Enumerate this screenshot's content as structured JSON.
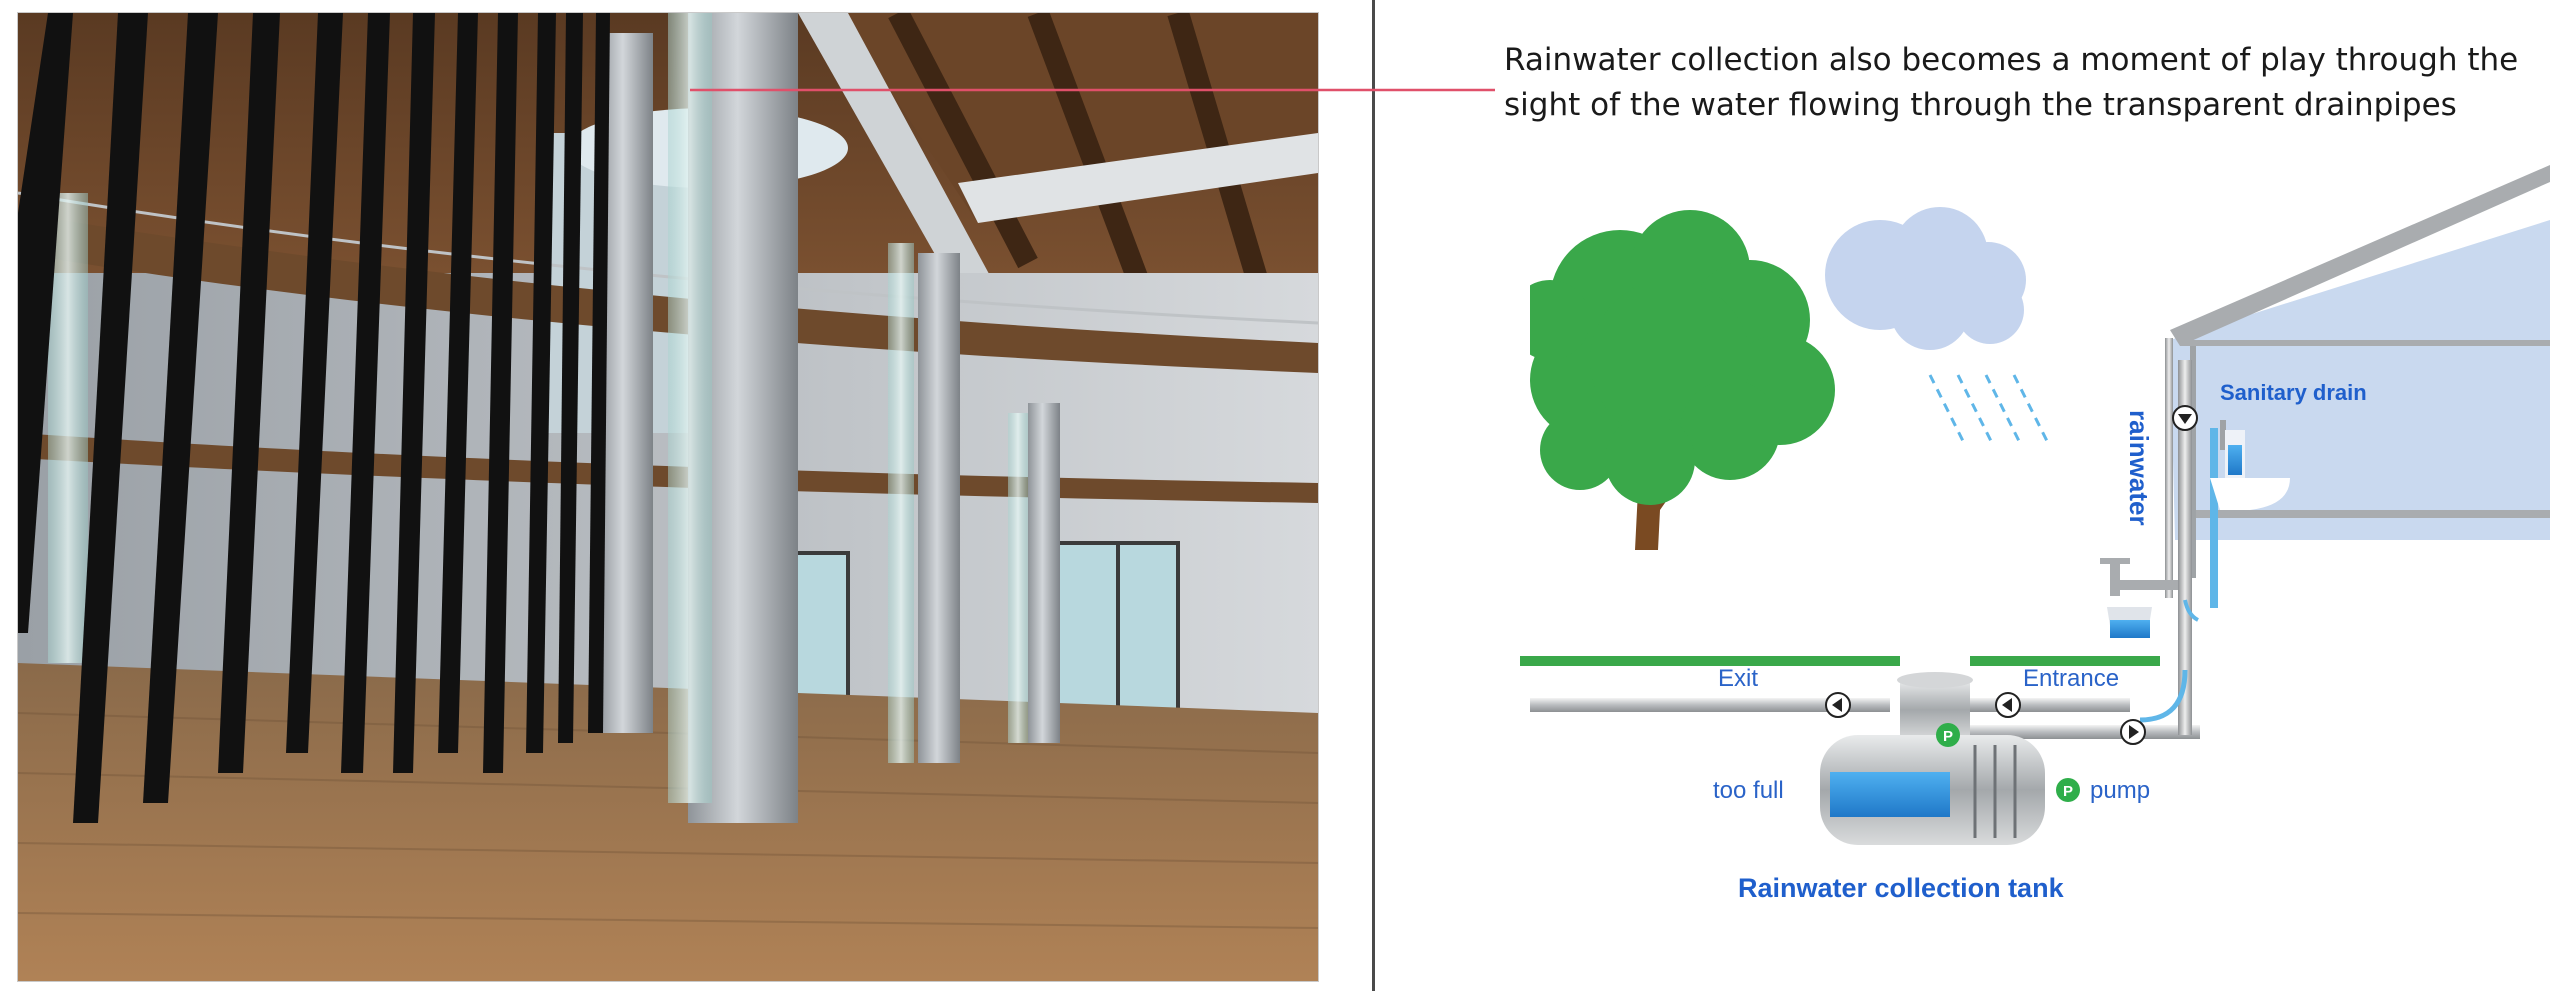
{
  "caption": {
    "line1": "Rainwater collection also becomes a moment of play through the",
    "line2": "sight of the water flowing through the transparent drainpipes"
  },
  "diagram": {
    "label_rainwater": "rainwater",
    "label_sanitary": "Sanitary drain",
    "label_exit": "Exit",
    "label_entrance": "Entrance",
    "label_too_full": "too full",
    "label_pump": "pump",
    "label_tank": "Rainwater collection tank",
    "pump_badge": "P"
  },
  "colors": {
    "label_blue": "#2a63c8",
    "leader_red": "#e0506a",
    "tree_green": "#3aa84a",
    "water_blue": "#2f8fd6",
    "pump_green": "#2fae4a"
  }
}
